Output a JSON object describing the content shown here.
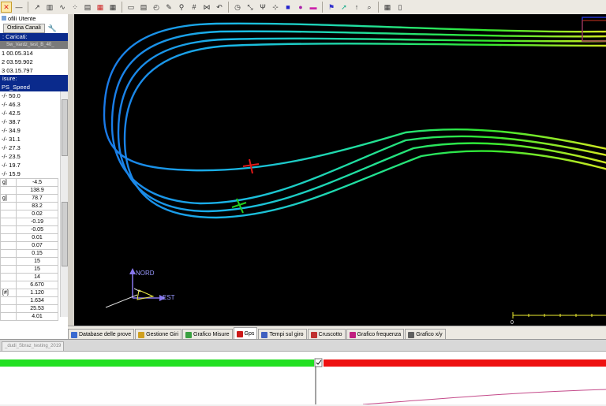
{
  "toolbar": {
    "icons": [
      "close-icon",
      "minus-icon",
      "line-chart-icon",
      "bar-chart-icon",
      "wave-chart-icon",
      "scatter-chart-icon",
      "stack-chart-icon",
      "stack-red-icon",
      "grid-icon",
      "window-icon",
      "database-icon",
      "gauge-icon",
      "pencil-icon",
      "wand-icon",
      "grid-lines-icon",
      "graph-icon",
      "undo-icon",
      "clock-icon",
      "resize-icon",
      "axis-icon",
      "cursor-plus-icon",
      "square-icon",
      "ellipse-icon",
      "rect-icon",
      "flag-icon",
      "arrow-icon",
      "arrow-up-icon",
      "zoom-icon",
      "table-icon",
      "document-icon"
    ]
  },
  "left_panel": {
    "profili_label": "ofili Utente",
    "ordina_label": "Ordina Canali",
    "caricati_header": ": Caricati:",
    "grey_strip": "Sw_Vardz_test_B_40_",
    "laps": [
      "1 00.05.314",
      "2 03.59.902",
      "3 03.15.797"
    ],
    "misure_header": "isure:",
    "selected_channel": "PS_Speed",
    "ranges": [
      "-/-  50.0",
      "-/-  46.3",
      "-/-  42.5",
      "-/-  38.7",
      "-/-  34.9",
      "-/-  31.1",
      "-/-  27.3",
      "-/-  23.5",
      "-/-  19.7",
      "-/-  15.9"
    ],
    "values": [
      {
        "label": "g]",
        "value": "-4.5"
      },
      {
        "label": "",
        "value": "138.9"
      },
      {
        "label": "g]",
        "value": "78.7"
      },
      {
        "label": "",
        "value": "83.2"
      },
      {
        "label": "",
        "value": "0.02"
      },
      {
        "label": "",
        "value": "-0.19"
      },
      {
        "label": "",
        "value": "-0.05"
      },
      {
        "label": "",
        "value": "0.01"
      },
      {
        "label": "",
        "value": "0.07"
      },
      {
        "label": "",
        "value": "0.15"
      },
      {
        "label": "",
        "value": "15"
      },
      {
        "label": "",
        "value": "15"
      },
      {
        "label": "",
        "value": "14"
      },
      {
        "label": "",
        "value": "6.670"
      },
      {
        "label": "[#]",
        "value": "1.120"
      },
      {
        "label": "",
        "value": "1.634"
      },
      {
        "label": "",
        "value": "25.53"
      },
      {
        "label": "",
        "value": "4.01"
      }
    ]
  },
  "gps": {
    "compass_north": "NORD",
    "compass_east": "EST"
  },
  "tabs": [
    {
      "label": "Database delle prove",
      "icon": "database-icon",
      "color": "#3a6ad0"
    },
    {
      "label": "Gestione Giri",
      "icon": "laps-icon",
      "color": "#d0a020"
    },
    {
      "label": "Grafico Misure",
      "icon": "chart-icon",
      "color": "#3aa040"
    },
    {
      "label": "Gps",
      "icon": "gps-icon",
      "color": "#cc1a1a",
      "active": true
    },
    {
      "label": "Tempi sul giro",
      "icon": "timing-icon",
      "color": "#4060c0"
    },
    {
      "label": "Cruscotto",
      "icon": "dashboard-icon",
      "color": "#c03030"
    },
    {
      "label": "Grafico frequenza",
      "icon": "frequency-icon",
      "color": "#c02080"
    },
    {
      "label": "Grafico x/y",
      "icon": "xy-icon",
      "color": "#606060"
    }
  ],
  "session_tab": "_dudi_Sbraz_testing_2019",
  "colors": {
    "accent_blue": "#0a2a8c",
    "bar_green": "#22e022",
    "bar_red": "#ee1111",
    "trace_pink": "#c44a8a"
  }
}
